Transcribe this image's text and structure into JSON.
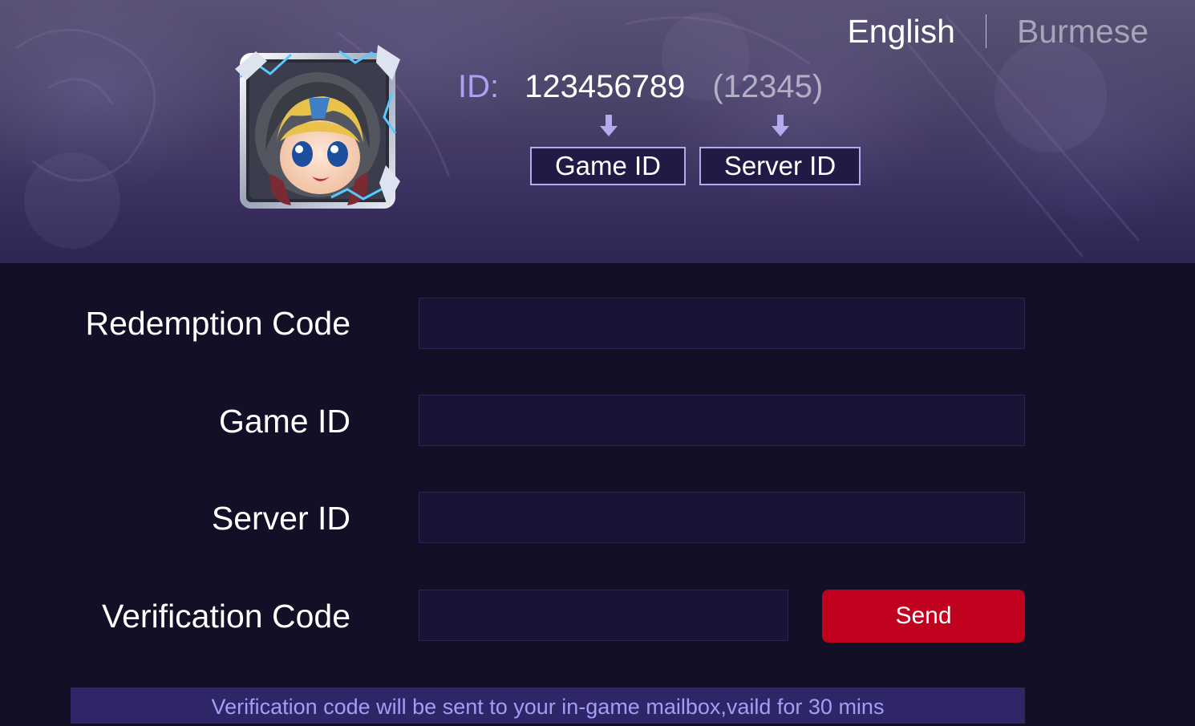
{
  "header": {
    "languages": [
      {
        "label": "English",
        "active": true
      },
      {
        "label": "Burmese",
        "active": false
      }
    ],
    "id_example": {
      "prefix": "ID:",
      "game_id": "123456789",
      "server_id": "(12345)",
      "game_id_label": "Game ID",
      "server_id_label": "Server ID"
    }
  },
  "form": {
    "redemption_code": {
      "label": "Redemption Code",
      "value": "",
      "placeholder": ""
    },
    "game_id": {
      "label": "Game ID",
      "value": "",
      "placeholder": ""
    },
    "server_id": {
      "label": "Server ID",
      "value": "",
      "placeholder": ""
    },
    "verification_code": {
      "label": "Verification Code",
      "value": "",
      "placeholder": ""
    },
    "send_label": "Send"
  },
  "notice": "Verification code will be sent to your in-game mailbox,vaild for 30 mins",
  "colors": {
    "accent": "#a9a2f2",
    "send_button": "#c0021f",
    "page_background": "#120f26",
    "notice_background": "#2e2666"
  }
}
